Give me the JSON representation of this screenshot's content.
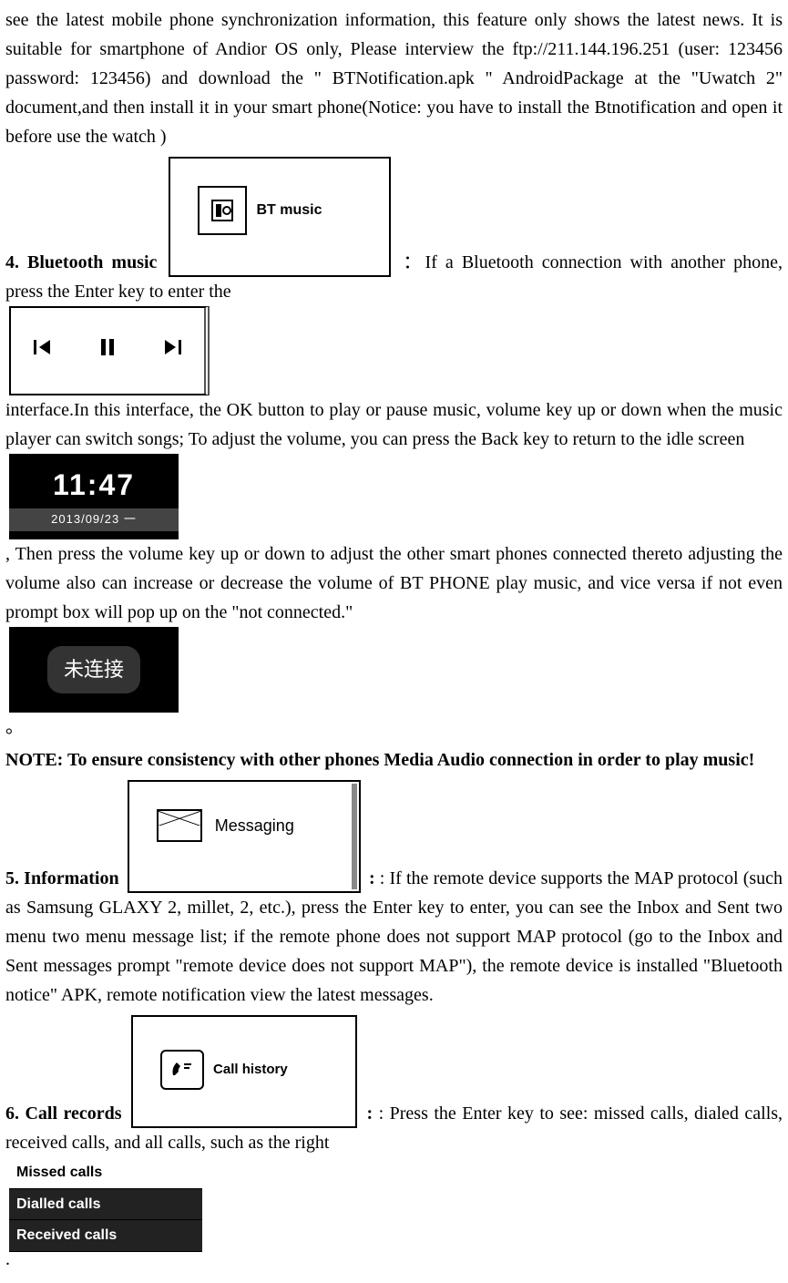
{
  "intro_paragraph": "see the latest mobile phone synchronization information, this feature only shows the latest news. It is suitable for smartphone of Andior OS only, Please interview the ftp://211.144.196.251 (user: 123456  password: 123456) and download the \" BTNotification.apk \" AndroidPackage at the \"Uwatch 2\" document,and then install  it in your smart phone(Notice: you have to install the Btnotification and open it before use the watch )",
  "section4": {
    "title": "4. Bluetooth music",
    "img_bt_label": "BT music",
    "text_a": "：If a Bluetooth connection with another phone, press the Enter key to enter the",
    "text_b": "interface.In this interface, the OK button to play or pause music, volume key up or down when the music player can switch songs; To adjust the volume, you can press the Back key to return to the idle screen",
    "clock_time": "11:47",
    "clock_date": "2013/09/23 一",
    "text_c": ", Then press the volume key up or down to adjust the other smart phones connected thereto adjusting the volume also can increase or decrease the volume of BT PHONE play music, and vice versa if not even prompt box will pop up on the \"not connected.\"",
    "not_connected_label": "未连接",
    "text_end": "。",
    "note": "NOTE: To ensure consistency with other phones Media Audio connection in order to play music!"
  },
  "section5": {
    "title": "5. Information",
    "img_label": "Messaging",
    "text": ": If the remote device supports the MAP protocol (such as Samsung GLAXY 2, millet, 2, etc.), press the Enter key to enter, you can see the Inbox and Sent two menu two menu message list; if the remote phone does not support MAP protocol (go to the Inbox and Sent messages prompt \"remote device does not support MAP\"), the remote device is installed \"Bluetooth notice\" APK, remote notification view the latest messages."
  },
  "section6": {
    "title": "6. Call records",
    "img_label": "Call history",
    "text_a": ": Press the Enter key to see: missed calls, dialed calls, received calls, and all calls, such as the right",
    "list": [
      "Missed calls",
      "Dialled calls",
      "Received calls"
    ],
    "text_end": "."
  }
}
